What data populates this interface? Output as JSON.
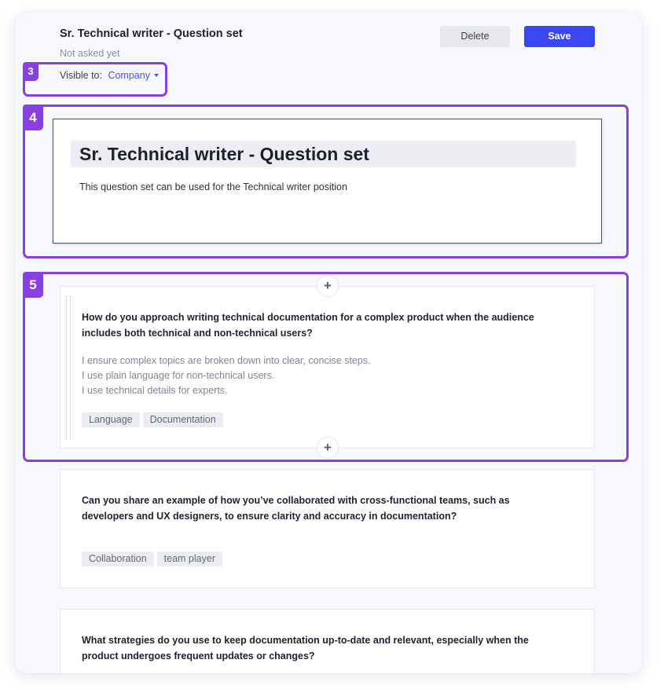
{
  "header": {
    "title": "Sr. Technical writer - Question set",
    "status": "Not asked yet",
    "visible_label": "Visible to:",
    "visible_value": "Company",
    "delete_label": "Delete",
    "save_label": "Save"
  },
  "badges": {
    "b3": "3",
    "b4": "4",
    "b5": "5"
  },
  "cover": {
    "title": "Sr. Technical writer - Question set",
    "description": "This question set can be used for the Technical writer position"
  },
  "add_symbol": "+",
  "questions": [
    {
      "text": "How do you approach writing technical documentation for a complex product when the audience includes both technical and non-technical users?",
      "answer": [
        "I ensure complex topics are broken down into clear, concise steps.",
        "I use plain language for non-technical users.",
        "I use technical details for experts."
      ],
      "tags": [
        "Language",
        "Documentation"
      ]
    },
    {
      "text": "Can you share an example of how you’ve collaborated with cross-functional teams, such as developers and UX designers, to ensure clarity and accuracy in documentation?",
      "tags": [
        "Collaboration",
        "team player"
      ]
    },
    {
      "text": "What strategies do you use to keep documentation up-to-date and relevant, especially when the product undergoes frequent updates or changes?"
    }
  ],
  "colors": {
    "accent": "#3b46f5",
    "highlight": "#8a3fe0",
    "link": "#4a50d8"
  }
}
